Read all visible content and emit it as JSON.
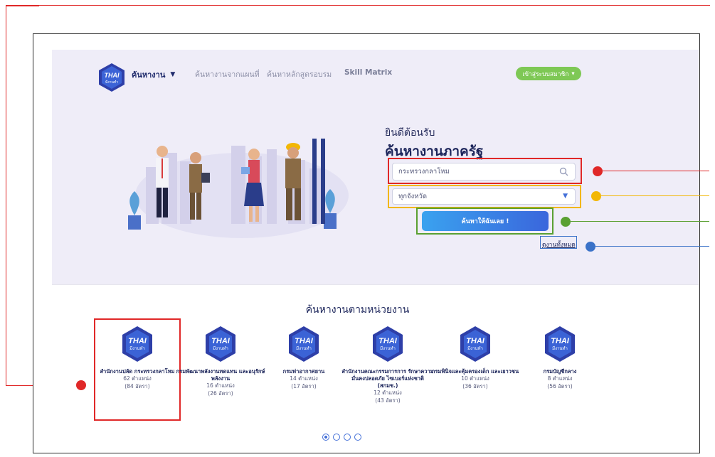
{
  "nav": {
    "brand": "THAI",
    "brand_sub": "มีงานทำ",
    "main_label": "ค้นหางาน",
    "caret": "▼",
    "links": [
      "ค้นหางานจากแผนที่",
      "ค้นหาหลักสูตรอบรม",
      "Skill Matrix"
    ],
    "login_label": "เข้าสู่ระบบสมาชิก",
    "login_caret": "▾"
  },
  "hero": {
    "welcome": "ยินดีต้อนรับ",
    "title": "ค้นหางานภาครัฐ",
    "search_value": "กระทรวงกลาโหม",
    "province_value": "ทุกจังหวัด",
    "province_arrow": "▼",
    "search_button": "ค้นหาให้ฉันเลย !",
    "all_jobs": "ดูงานทั้งหมด"
  },
  "section": {
    "title": "ค้นหางานตามหน่วยงาน",
    "agencies": [
      {
        "name": "สำนักงานปลัด กระทรวงกลาโหม",
        "positions": "62 ตำแหน่ง",
        "rates": "(84 อัตรา)"
      },
      {
        "name": "กรมพัฒนาพลังงานทดแทน และอนุรักษ์พลังงาน",
        "positions": "16 ตำแหน่ง",
        "rates": "(26 อัตรา)"
      },
      {
        "name": "กรมท่าอากาศยาน",
        "positions": "14 ตำแหน่ง",
        "rates": "(17 อัตรา)"
      },
      {
        "name": "สำนักงานคณะกรรมการการ รักษาความมั่นคงปลอดภัย ไซเบอร์แห่งชาติ (สกมช.)",
        "positions": "12 ตำแหน่ง",
        "rates": "(43 อัตรา)"
      },
      {
        "name": "กรมพินิจและคุ้มครองเด็ก และเยาวชน",
        "positions": "10 ตำแหน่ง",
        "rates": "(36 อัตรา)"
      },
      {
        "name": "กรมบัญชีกลาง",
        "positions": "8 ตำแหน่ง",
        "rates": "(56 อัตรา)"
      }
    ],
    "pages": 4,
    "active_page": 1
  },
  "colors": {
    "annotation_red": "#e02828",
    "annotation_yellow": "#f2b705",
    "annotation_green": "#5aa032",
    "annotation_blue": "#3a72c8",
    "login_green": "#7ec855",
    "brand_navy": "#1a2359"
  },
  "icons": [
    "thai-logo",
    "search-icon",
    "chevron-down-icon"
  ]
}
